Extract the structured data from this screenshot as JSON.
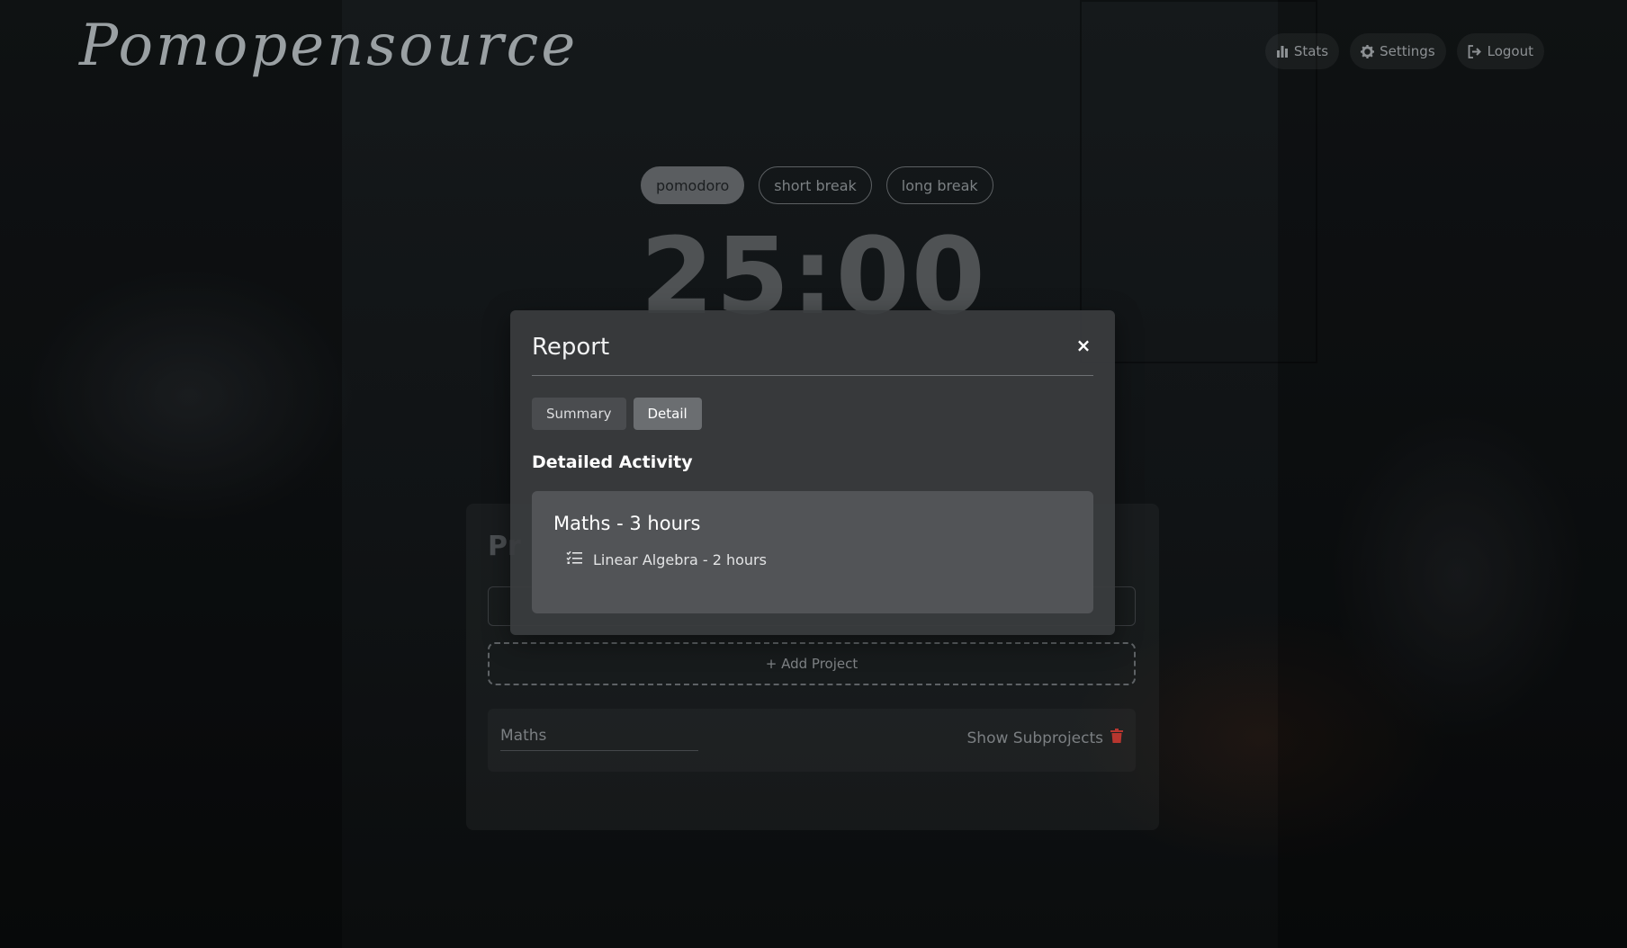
{
  "app": {
    "logo_text": "Pomopensource"
  },
  "header": {
    "nav": [
      {
        "label": "Stats",
        "icon": "bar-chart-icon"
      },
      {
        "label": "Settings",
        "icon": "gear-icon"
      },
      {
        "label": "Logout",
        "icon": "logout-icon"
      }
    ]
  },
  "timer": {
    "modes": [
      "pomodoro",
      "short break",
      "long break"
    ],
    "active_mode": "pomodoro",
    "time": "25:00"
  },
  "projects": {
    "title": "Pr",
    "add_label": "+ Add Project",
    "items": [
      {
        "name": "Maths",
        "toggle_label": "Show Subprojects"
      }
    ]
  },
  "modal": {
    "title": "Report",
    "close_label": "×",
    "tabs": [
      {
        "label": "Summary",
        "active": false
      },
      {
        "label": "Detail",
        "active": true
      }
    ],
    "section_title": "Detailed Activity",
    "activities": [
      {
        "project": "Maths - 3 hours",
        "subprojects": [
          {
            "label": "Linear Algebra - 2 hours",
            "icon": "task-list-icon"
          }
        ]
      }
    ]
  },
  "colors": {
    "background": "#121517",
    "modal_bg": "#3a3c3e",
    "card_bg": "#525457",
    "delete_icon": "#b8362f"
  }
}
